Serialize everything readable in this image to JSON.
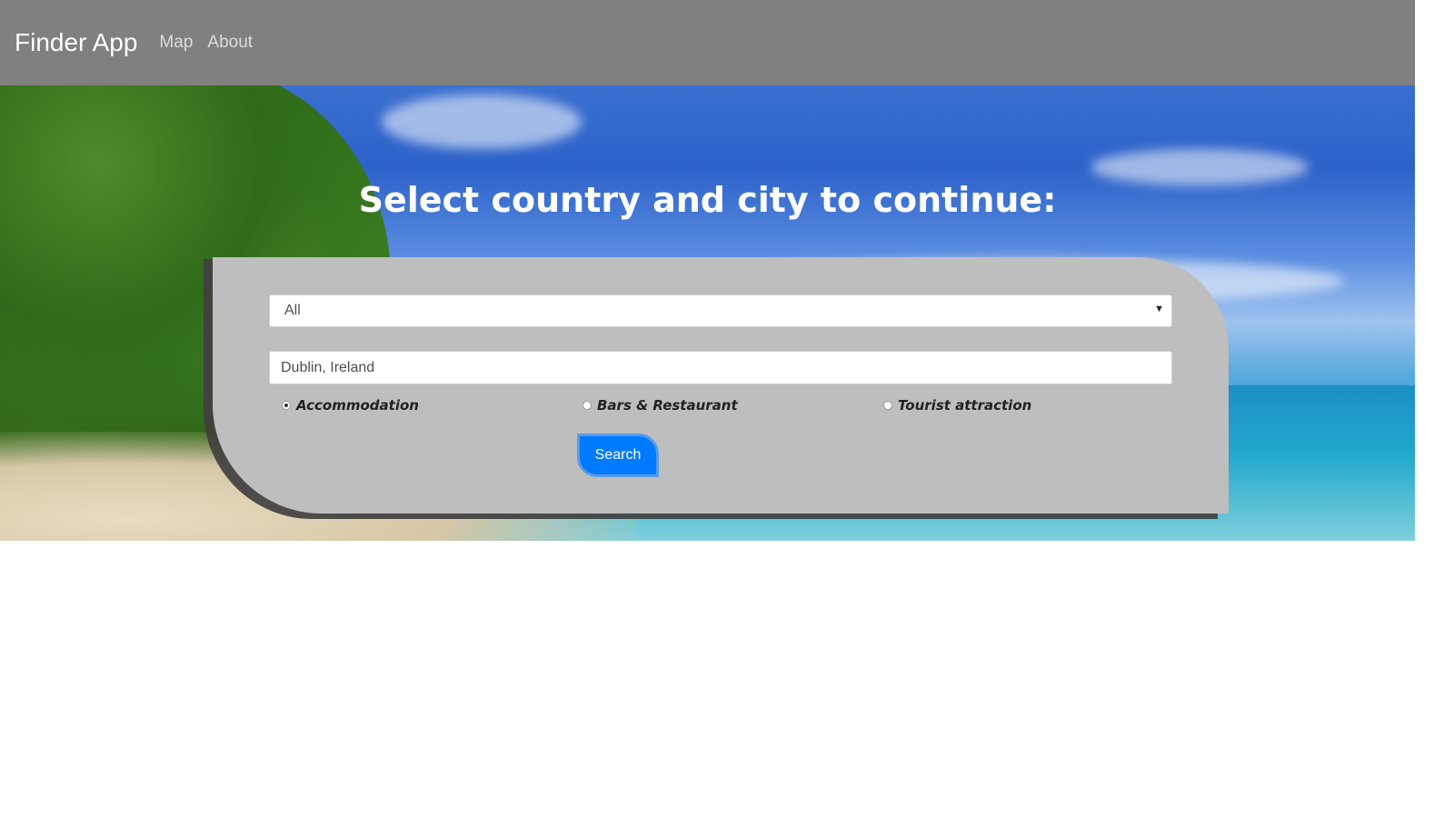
{
  "navbar": {
    "brand": "Finder App",
    "links": [
      "Map",
      "About"
    ]
  },
  "hero": {
    "title": "Select country and city to continue:"
  },
  "form": {
    "category_select": {
      "selected": "All"
    },
    "location_input": {
      "value": "Dublin, Ireland"
    },
    "radios": [
      {
        "label": "Accommodation",
        "checked": true
      },
      {
        "label": "Bars & Restaurant",
        "checked": false
      },
      {
        "label": "Tourist attraction",
        "checked": false
      }
    ],
    "search_label": "Search"
  },
  "colors": {
    "navbar": "#808080",
    "card": "#bebebe",
    "search_button": "#007bff"
  }
}
